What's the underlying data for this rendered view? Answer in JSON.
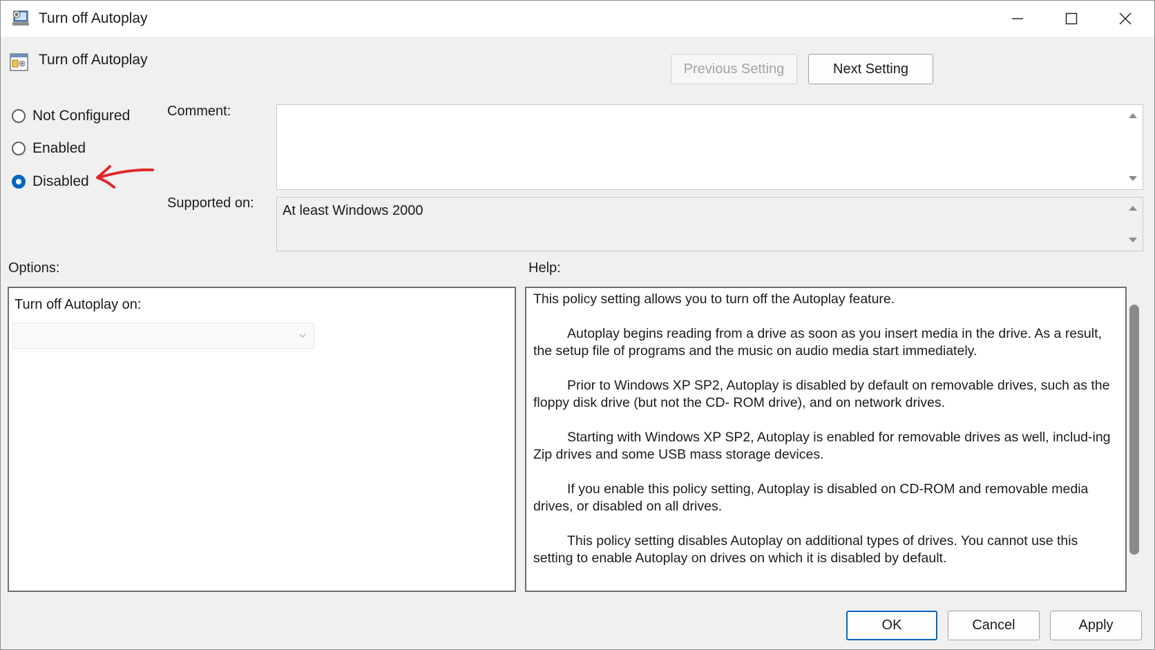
{
  "window": {
    "title": "Turn off Autoplay",
    "icon": "policy-window-icon",
    "controls": [
      "minimize-icon",
      "maximize-icon",
      "close-icon"
    ]
  },
  "header": {
    "title": "Turn off Autoplay",
    "icon": "policy-setting-icon",
    "previous_label": "Previous Setting",
    "next_label": "Next Setting"
  },
  "state": {
    "options": [
      {
        "label": "Not Configured",
        "checked": false
      },
      {
        "label": "Enabled",
        "checked": false
      },
      {
        "label": "Disabled",
        "checked": true
      }
    ]
  },
  "comment": {
    "label": "Comment:",
    "value": ""
  },
  "supported": {
    "label": "Supported on:",
    "value": "At least Windows 2000"
  },
  "options_panel": {
    "label": "Options:",
    "field_label": "Turn off Autoplay on:",
    "select_value": ""
  },
  "help": {
    "label": "Help:",
    "paragraphs": [
      "This policy setting allows you to turn off the Autoplay feature.",
      "Autoplay begins reading from a drive as soon as you insert media in the drive. As a result, the setup file of programs and the music on audio media start immediately.",
      "Prior to Windows XP SP2, Autoplay is disabled by default on removable drives, such as the floppy disk drive (but not the CD- ROM drive), and on network drives.",
      "Starting with Windows XP SP2, Autoplay is enabled for removable drives as well, includ-ing Zip drives and some USB mass storage devices.",
      "If you enable this policy setting, Autoplay is disabled on CD-ROM and removable media drives, or disabled on all drives.",
      "This policy setting disables Autoplay on additional types of drives. You cannot use this setting to enable Autoplay on drives on which it is disabled by default."
    ]
  },
  "footer": {
    "ok_label": "OK",
    "cancel_label": "Cancel",
    "apply_label": "Apply"
  },
  "colors": {
    "accent": "#0067c0",
    "annotation": "#e0282a"
  }
}
